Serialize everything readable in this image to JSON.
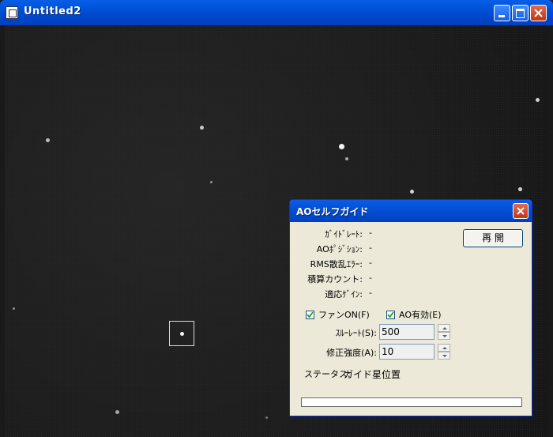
{
  "window": {
    "title": "Untitled2"
  },
  "dialog": {
    "title": "AOセルフガイド",
    "restart_label": "再 開",
    "rows": [
      {
        "label": "ｶﾞｲﾄﾞﾚｰﾄ:",
        "value": "-"
      },
      {
        "label": "AOﾎﾟｼﾞｼｮﾝ:",
        "value": "-"
      },
      {
        "label": "RMS散乱ｴﾗｰ:",
        "value": "-"
      },
      {
        "label": "積算カウント:",
        "value": "-"
      },
      {
        "label": "適応ｹﾞｲﾝ:",
        "value": "-"
      }
    ],
    "fan_label": "ファンON(F)",
    "ao_label": "AO有効(E)",
    "slew_label": "ｽﾙｰﾚｰﾄ(S):",
    "slew_value": "500",
    "correction_label": "修正強度(A):",
    "correction_value": "10",
    "status_label": "ステータス:",
    "status_value": "ガイド星位置",
    "progress": 0,
    "fan_checked": true,
    "ao_checked": true
  },
  "colors": {
    "titlebar": "#0058e0",
    "dialog_bg": "#ece9d8",
    "close": "#c0361a"
  },
  "icons": [
    "window-icon",
    "minimize-icon",
    "maximize-icon",
    "close-icon",
    "check-icon",
    "spin-up-icon",
    "spin-down-icon"
  ]
}
